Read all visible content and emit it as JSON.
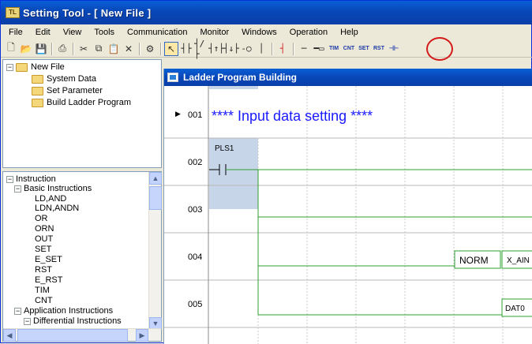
{
  "window": {
    "title": "Setting Tool - [ New File ]",
    "icon_text": "TL"
  },
  "menu": [
    "File",
    "Edit",
    "View",
    "Tools",
    "Communication",
    "Monitor",
    "Windows",
    "Operation",
    "Help"
  ],
  "toolbar": {
    "tim_label": "TIM",
    "cnt_label": "CNT",
    "set_label": "SET",
    "rst_label": "RST"
  },
  "project_tree": {
    "root": "New File",
    "children": [
      "System Data",
      "Set Parameter",
      "Build Ladder Program"
    ]
  },
  "instruction_tree": {
    "root": "Instruction",
    "basic_group": "Basic Instructions",
    "basic_items": [
      "LD,AND",
      "LDN,ANDN",
      "OR",
      "ORN",
      "OUT",
      "SET",
      "E_SET",
      "RST",
      "E_RST",
      "TIM",
      "CNT"
    ],
    "app_group": "Application Instructions",
    "diff_group": "Differential Instructions"
  },
  "ladder": {
    "title": "Ladder Program Building",
    "rows": [
      "001",
      "002",
      "003",
      "004",
      "005"
    ],
    "comment": "**** Input data setting ****",
    "contact_label": "PLS1",
    "norm_label": "NORM",
    "x_ain_label": "X_AIN",
    "dat_label": "DAT0"
  },
  "colors": {
    "title_bar": "#0847b8",
    "ladder_line": "#2da02d",
    "comment_text": "#1a1aff",
    "highlight_circle": "#d41a1a"
  }
}
